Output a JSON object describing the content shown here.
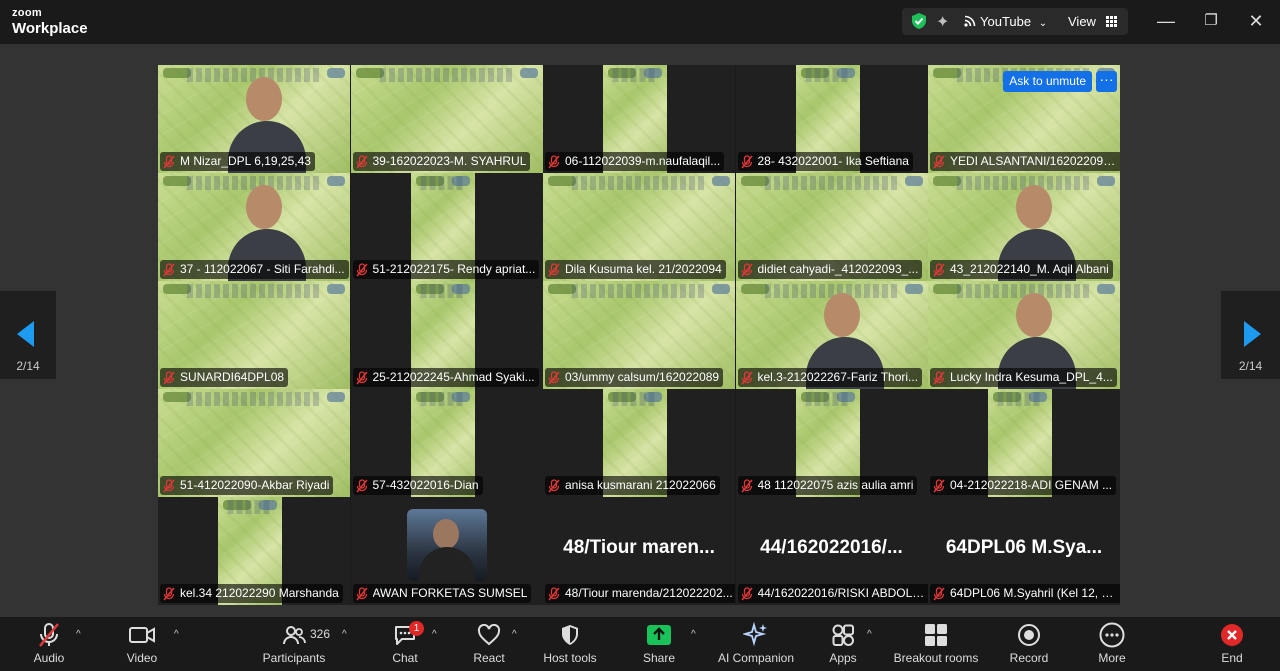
{
  "app": {
    "brand_line1": "zoom",
    "brand_line2": "Workplace"
  },
  "titlebar": {
    "youtube_label": "YouTube",
    "view_label": "View",
    "icons": [
      "shield-check-icon",
      "sparkle-icon",
      "broadcast-icon",
      "chevron-down-icon",
      "grid-icon",
      "minimize-icon",
      "restore-icon",
      "close-icon"
    ]
  },
  "navigation": {
    "prev_page": "2/14",
    "next_page": "2/14"
  },
  "tile_overlay": {
    "ask_to_unmute": "Ask to unmute",
    "more_label": "···"
  },
  "participants_grid": [
    {
      "name": "M Nizar_DPL 6,19,25,43",
      "type": "full",
      "person": true
    },
    {
      "name": "39-162022023-M. SYAHRUL",
      "type": "full",
      "person": false
    },
    {
      "name": "06-112022039-m.naufalaqil...",
      "type": "narrow",
      "person": false
    },
    {
      "name": "28- 432022001- Ika Seftiana",
      "type": "narrow",
      "person": false
    },
    {
      "name": "YEDI ALSANTANI/162022094...",
      "type": "full",
      "person": false,
      "overlay": true
    },
    {
      "name": "37 - 112022067 - Siti Farahdi...",
      "type": "full",
      "person": true
    },
    {
      "name": "51-212022175- Rendy apriat...",
      "type": "narrow",
      "person": false
    },
    {
      "name": "Dila Kusuma kel. 21/2022094",
      "type": "full",
      "person": false
    },
    {
      "name": "didiet cahyadi-_412022093_...",
      "type": "full",
      "person": false
    },
    {
      "name": "43_212022140_M. Aqil Albani",
      "type": "full",
      "person": true
    },
    {
      "name": "SUNARDI64DPL08",
      "type": "full",
      "person": false
    },
    {
      "name": "25-212022245-Ahmad Syaki...",
      "type": "narrow",
      "person": false
    },
    {
      "name": "03/ummy calsum/162022089",
      "type": "full",
      "person": false
    },
    {
      "name": "kel.3-212022267-Fariz Thori...",
      "type": "full",
      "person": true
    },
    {
      "name": "Lucky Indra Kesuma_DPL_4...",
      "type": "full",
      "person": true
    },
    {
      "name": "51-412022090-Akbar Riyadi",
      "type": "full",
      "person": false
    },
    {
      "name": "57-432022016-Dian",
      "type": "narrow",
      "person": false
    },
    {
      "name": "anisa kusmarani 212022066",
      "type": "narrow",
      "person": false
    },
    {
      "name": "48 112022075 azis aulia amri",
      "type": "narrow",
      "person": false
    },
    {
      "name": "04-212022218-ADI GENAM ...",
      "type": "narrow",
      "person": false
    },
    {
      "name": "kel.34 212022290 Marshanda",
      "type": "narrow",
      "person": false
    },
    {
      "name": "AWAN FORKETAS SUMSEL",
      "type": "avatar",
      "person": false
    },
    {
      "name": "48/Tiour marenda/212022202...",
      "type": "text",
      "big": "48/Tiour maren..."
    },
    {
      "name": "44/162022016/RISKI ABDOLL...",
      "type": "text",
      "big": "44/162022016/..."
    },
    {
      "name": "64DPL06 M.Syahril (Kel 12, 2...",
      "type": "text",
      "big": "64DPL06 M.Sya..."
    }
  ],
  "toolbar": {
    "audio": "Audio",
    "video": "Video",
    "participants": "Participants",
    "participant_count": "326",
    "chat": "Chat",
    "chat_badge": "1",
    "react": "React",
    "host_tools": "Host tools",
    "share": "Share",
    "ai_companion": "AI Companion",
    "apps": "Apps",
    "breakout_rooms": "Breakout rooms",
    "record": "Record",
    "more": "More",
    "end": "End"
  },
  "colors": {
    "accent_blue": "#1470e6",
    "share_green": "#19c35a",
    "end_red": "#e02828",
    "muted_red": "#e03838",
    "shield_green": "#1fbf5a"
  }
}
